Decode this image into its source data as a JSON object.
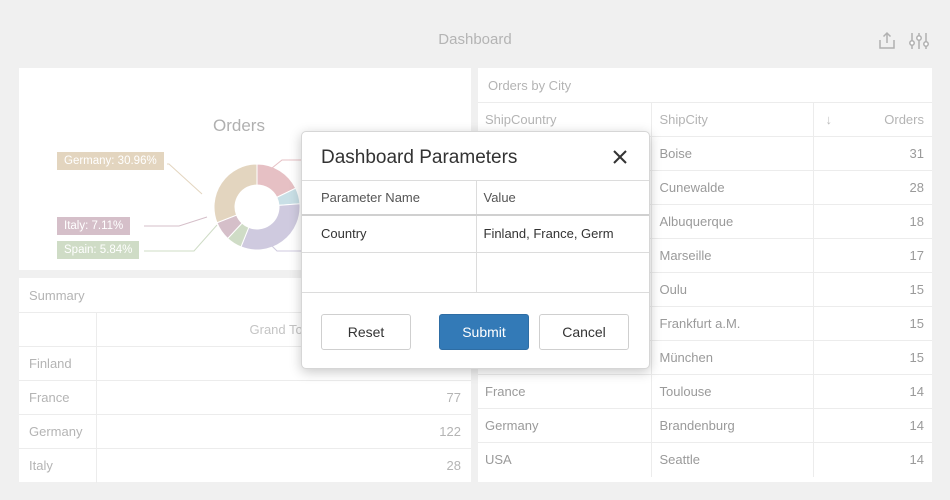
{
  "dashboard": {
    "title": "Dashboard"
  },
  "toolbar": {
    "export_icon": "export-icon",
    "parameters_icon": "sliders-icon"
  },
  "orders_chart": {
    "title": "Orders",
    "chart_data": {
      "type": "pie",
      "title": "Orders",
      "donut": true,
      "slices": [
        {
          "label": "Germany: 30.96%",
          "value": 30.96,
          "color": "#e3d5bf"
        },
        {
          "label": "Italy: 7.11%",
          "value": 7.11,
          "color": "#d5bfc9"
        },
        {
          "label": "Spain: 5.84%",
          "value": 5.84,
          "color": "#cfdcc6"
        }
      ],
      "hidden_slices": [
        {
          "value": 17.8,
          "color": "#e6c0c4"
        },
        {
          "value": 6.0,
          "color": "#c9dfe6"
        },
        {
          "value": 32.29,
          "color": "#cfcadf"
        }
      ]
    }
  },
  "summary": {
    "title": "Summary",
    "header": [
      "",
      "Grand Total"
    ],
    "rows": [
      {
        "country": "Finland",
        "total": ""
      },
      {
        "country": "France",
        "total": "77"
      },
      {
        "country": "Germany",
        "total": "122"
      },
      {
        "country": "Italy",
        "total": "28"
      }
    ]
  },
  "city_grid": {
    "title": "Orders by City",
    "columns": [
      "ShipCountry",
      "ShipCity",
      "Orders"
    ],
    "sort_icon": "sort-descending-icon",
    "rows": [
      {
        "country": "",
        "city": "Boise",
        "orders": "31"
      },
      {
        "country": "",
        "city": "Cunewalde",
        "orders": "28"
      },
      {
        "country": "",
        "city": "Albuquerque",
        "orders": "18"
      },
      {
        "country": "",
        "city": "Marseille",
        "orders": "17"
      },
      {
        "country": "",
        "city": "Oulu",
        "orders": "15"
      },
      {
        "country": "",
        "city": "Frankfurt a.M.",
        "orders": "15"
      },
      {
        "country": "",
        "city": "München",
        "orders": "15"
      },
      {
        "country": "France",
        "city": "Toulouse",
        "orders": "14"
      },
      {
        "country": "Germany",
        "city": "Brandenburg",
        "orders": "14"
      },
      {
        "country": "USA",
        "city": "Seattle",
        "orders": "14"
      }
    ]
  },
  "dialog": {
    "title": "Dashboard Parameters",
    "close_icon": "close-icon",
    "columns": [
      "Parameter Name",
      "Value"
    ],
    "parameters": [
      {
        "name": "Country",
        "value": "Finland, France, Germ"
      }
    ],
    "buttons": {
      "reset": "Reset",
      "submit": "Submit",
      "cancel": "Cancel"
    },
    "accent_color": "#337ab7"
  }
}
